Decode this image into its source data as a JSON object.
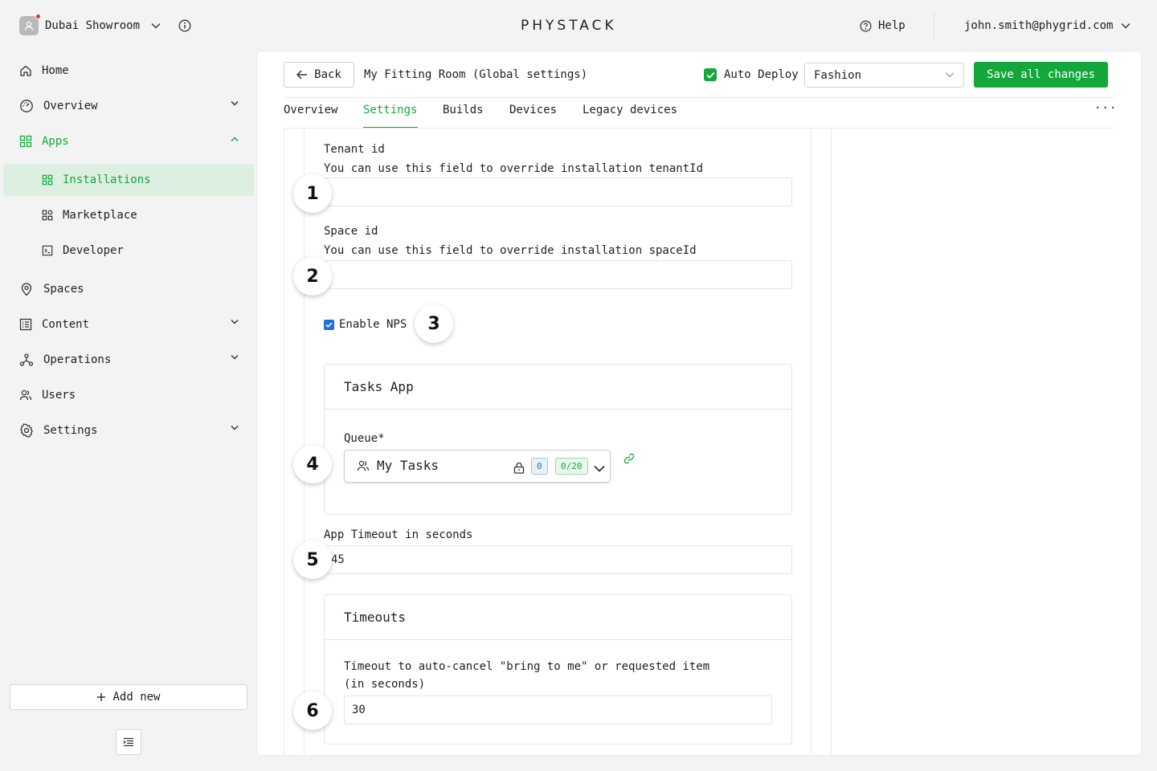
{
  "org": {
    "name": "Dubai Showroom"
  },
  "brand": {
    "logo": "PHYSTACK"
  },
  "header": {
    "help": "Help",
    "user_email": "john.smith@phygrid.com"
  },
  "sidebar": {
    "items": [
      {
        "label": "Home",
        "icon": "home-icon"
      },
      {
        "label": "Overview",
        "icon": "gauge-icon"
      },
      {
        "label": "Apps",
        "icon": "apps-grid-icon"
      },
      {
        "label": "Installations",
        "icon": "apps-grid-icon"
      },
      {
        "label": "Marketplace",
        "icon": "marketplace-icon"
      },
      {
        "label": "Developer",
        "icon": "terminal-icon"
      },
      {
        "label": "Spaces",
        "icon": "location-pin-icon"
      },
      {
        "label": "Content",
        "icon": "list-icon"
      },
      {
        "label": "Operations",
        "icon": "nodes-icon"
      },
      {
        "label": "Users",
        "icon": "users-icon"
      },
      {
        "label": "Settings",
        "icon": "gear-icon"
      }
    ],
    "add_new": "Add new"
  },
  "page": {
    "back": "Back",
    "title": "My Fitting Room (Global settings)",
    "auto_deploy": "Auto Deploy",
    "auto_deploy_checked": true,
    "environment": "Fashion",
    "save": "Save all changes",
    "more": "···"
  },
  "tabs": [
    {
      "label": "Overview"
    },
    {
      "label": "Settings",
      "active": true
    },
    {
      "label": "Builds"
    },
    {
      "label": "Devices"
    },
    {
      "label": "Legacy devices"
    }
  ],
  "form": {
    "tenant_label": "Tenant id",
    "tenant_help": "You can use this field to override installation tenantId",
    "tenant_value": "",
    "space_label": "Space id",
    "space_help": "You can use this field to override installation spaceId",
    "space_value": "",
    "nps_label": "Enable NPS",
    "nps_checked": true,
    "tasks_card_title": "Tasks App",
    "queue_label": "Queue*",
    "queue_value": "My Tasks",
    "queue_badge_count": "0",
    "queue_badge_capacity": "0/20",
    "timeout_label": "App Timeout in seconds",
    "timeout_value": "45",
    "timeouts_card_title": "Timeouts",
    "cancel_timeout_label_1": "Timeout to auto-cancel \"bring to me\" or requested item",
    "cancel_timeout_label_2": "(in seconds)",
    "cancel_timeout_value": "30"
  },
  "markers": [
    "1",
    "2",
    "3",
    "4",
    "5",
    "6"
  ],
  "colors": {
    "accent": "#14a83c",
    "active_bg": "#dcefe0",
    "checkbox_blue": "#1f6fe6"
  }
}
